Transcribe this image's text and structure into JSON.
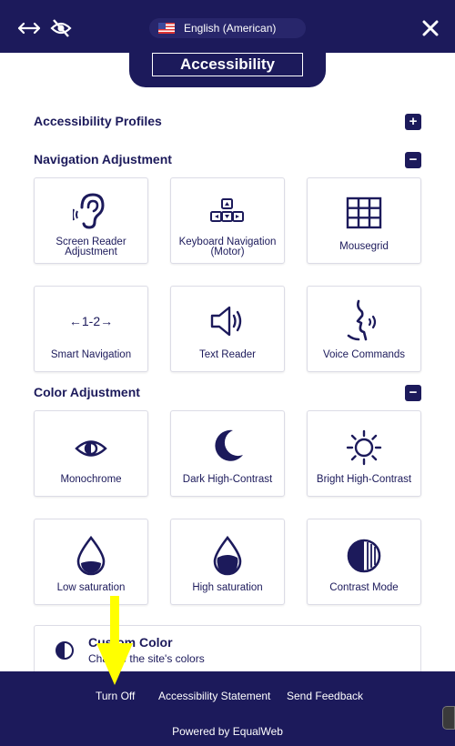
{
  "header": {
    "language": "English (American)",
    "title": "Accessibility"
  },
  "sections": {
    "profiles": "Accessibility Profiles",
    "navigation": "Navigation Adjustment",
    "color": "Color Adjustment"
  },
  "toggles": {
    "plus": "+",
    "minus": "−"
  },
  "navigation_cards": [
    {
      "label": "Screen Reader Adjustment",
      "icon": "ear-icon"
    },
    {
      "label": "Keyboard Navigation (Motor)",
      "icon": "keyboard-icon"
    },
    {
      "label": "Mousegrid",
      "icon": "grid-icon"
    },
    {
      "label": "Smart Navigation",
      "icon": "smart-navigation-icon"
    },
    {
      "label": "Text Reader",
      "icon": "speaker-icon"
    },
    {
      "label": "Voice Commands",
      "icon": "voice-head-icon"
    }
  ],
  "navigation_smart_icon_text": "←1-2→",
  "color_cards": [
    {
      "label": "Monochrome",
      "icon": "eye-icon"
    },
    {
      "label": "Dark High-Contrast",
      "icon": "moon-icon"
    },
    {
      "label": "Bright High-Contrast",
      "icon": "sun-icon"
    },
    {
      "label": "Low saturation",
      "icon": "drop-low-icon"
    },
    {
      "label": "High saturation",
      "icon": "drop-high-icon"
    },
    {
      "label": "Contrast Mode",
      "icon": "contrast-mode-icon"
    }
  ],
  "custom_color": {
    "title": "Custom Color",
    "description": "Change the site's colors"
  },
  "footer": {
    "turn_off": "Turn Off",
    "statement": "Accessibility Statement",
    "feedback": "Send Feedback",
    "powered": "Powered by EqualWeb"
  },
  "colors": {
    "brand": "#1c1a5b",
    "background": "#ffffff",
    "annotation_arrow": "#ffff00"
  }
}
